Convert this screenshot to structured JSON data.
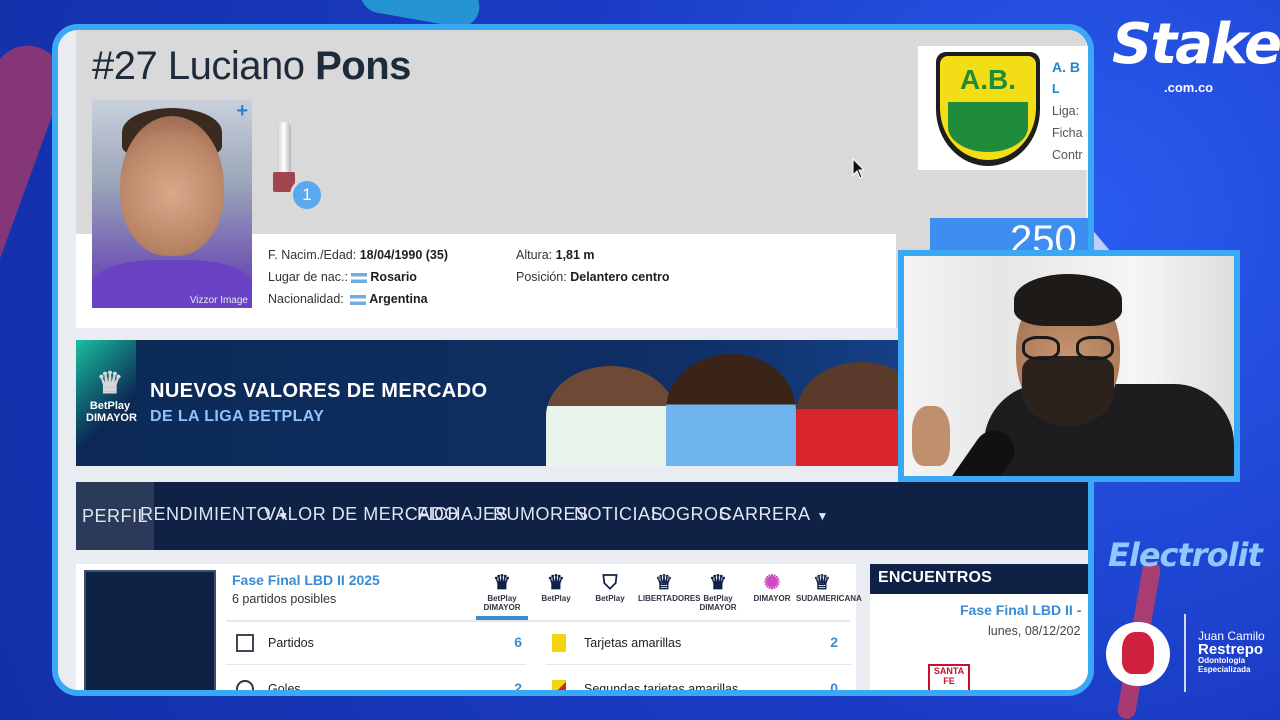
{
  "player": {
    "number": "#27",
    "first_name": "Luciano",
    "last_name": "Pons",
    "photo_credit": "Vizzor Image",
    "trophy_count": "1",
    "birth_label": "F. Nacim./Edad:",
    "birth_value": "18/04/1990 (35)",
    "birthplace_label": "Lugar de nac.:",
    "birthplace_value": "Rosario",
    "nationality_label": "Nacionalidad:",
    "nationality_value": "Argentina",
    "height_label": "Altura:",
    "height_value": "1,81 m",
    "position_label": "Posición:",
    "position_value": "Delantero centro"
  },
  "club": {
    "logo_text": "A.B.",
    "name_partial": "A. B",
    "league_partial": "L",
    "liga_label": "Liga:",
    "ficha_label": "Ficha",
    "contrato_label": "Contr"
  },
  "market_value_partial": "250",
  "banner": {
    "logo_text": "BetPlay DIMAYOR",
    "line1": "NUEVOS VALORES DE MERCADO",
    "line2": "DE LA LIGA BETPLAY"
  },
  "nav": {
    "items": [
      "PERFIL",
      "RENDIMIENTO",
      "VALOR DE MERCADO",
      "FICHAJES",
      "RUMORES",
      "NOTICIAS",
      "LOGROS",
      "CARRERA"
    ],
    "active": "PERFIL"
  },
  "competition": {
    "title": "Fase Final LBD II 2025",
    "subtitle": "6 partidos posibles",
    "logos": [
      "BetPlay DIMAYOR",
      "BetPlay",
      "BetPlay",
      "LIBERTADORES",
      "BetPlay DIMAYOR",
      "DIMAYOR",
      "SUDAMERICANA"
    ]
  },
  "stats": {
    "partidos_label": "Partidos",
    "partidos_value": "6",
    "goles_label": "Goles",
    "goles_value": "2",
    "amarillas_label": "Tarjetas amarillas",
    "amarillas_value": "2",
    "segundas_label": "Segundas tarjetas amarillas",
    "segundas_value": "0"
  },
  "encuentros": {
    "header": "ENCUENTROS",
    "title": "Fase Final LBD II -",
    "date": "lunes, 08/12/202",
    "team": "SANTA FE"
  },
  "sponsors": {
    "stake": "Stake",
    "stake_domain": ".com.co",
    "electrolit": "Electrolit",
    "jcr_line1": "Juan Camilo",
    "jcr_line2": "Restrepo",
    "jcr_line3": "Odontología",
    "jcr_line4": "Especializada"
  },
  "colors": {
    "accent_blue": "#3b8bd3",
    "nav_bg": "#0f2246",
    "frame_border": "#39a8f5",
    "stream_bg": "#1b3fc7"
  }
}
